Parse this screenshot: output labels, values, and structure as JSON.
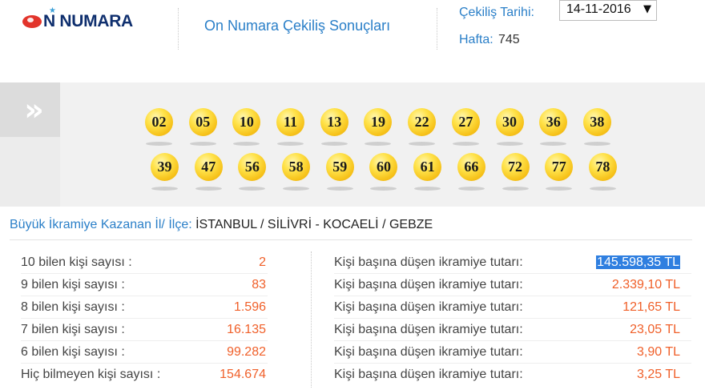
{
  "header": {
    "logo_text": "N NUMARA",
    "logo_star": "★",
    "page_title": "On Numara Çekiliş Sonuçları",
    "draw_date_label": "Çekiliş Tarihi:",
    "draw_date_value": "14-11-2016",
    "draw_date_caret": "▼",
    "week_label": "Hafta:",
    "week_value": "745"
  },
  "band": {
    "arrow_glyph": "»",
    "numbers_row1": [
      "02",
      "05",
      "10",
      "11",
      "13",
      "19",
      "22",
      "27",
      "30",
      "36",
      "38"
    ],
    "numbers_row2": [
      "39",
      "47",
      "56",
      "58",
      "59",
      "60",
      "61",
      "66",
      "72",
      "77",
      "78"
    ]
  },
  "winner": {
    "label": "Büyük İkramiye Kazanan İl/ İlçe:",
    "value": "İSTANBUL / SİLİVRİ - KOCAELİ / GEBZE"
  },
  "results": [
    {
      "label": "10 bilen kişi sayısı :",
      "count": "2",
      "prize_label": "Kişi başına düşen ikramiye tutarı:",
      "prize": "145.598,35 TL",
      "highlighted": true
    },
    {
      "label": "9 bilen kişi sayısı :",
      "count": "83",
      "prize_label": "Kişi başına düşen ikramiye tutarı:",
      "prize": "2.339,10 TL",
      "highlighted": false
    },
    {
      "label": "8 bilen kişi sayısı :",
      "count": "1.596",
      "prize_label": "Kişi başına düşen ikramiye tutarı:",
      "prize": "121,65 TL",
      "highlighted": false
    },
    {
      "label": "7 bilen kişi sayısı :",
      "count": "16.135",
      "prize_label": "Kişi başına düşen ikramiye tutarı:",
      "prize": "23,05 TL",
      "highlighted": false
    },
    {
      "label": "6 bilen kişi sayısı :",
      "count": "99.282",
      "prize_label": "Kişi başına düşen ikramiye tutarı:",
      "prize": "3,90 TL",
      "highlighted": false
    },
    {
      "label": "Hiç bilmeyen kişi sayısı :",
      "count": "154.674",
      "prize_label": "Kişi başına düşen ikramiye tutarı:",
      "prize": "3,25 TL",
      "highlighted": false
    }
  ],
  "colors": {
    "link_blue": "#2a7fc8",
    "value_orange": "#f0602a",
    "ball_yellow": "#ffe24a",
    "logo_navy": "#0f2f6e",
    "logo_red": "#e2342b",
    "highlight_blue": "#2f7fe0"
  }
}
